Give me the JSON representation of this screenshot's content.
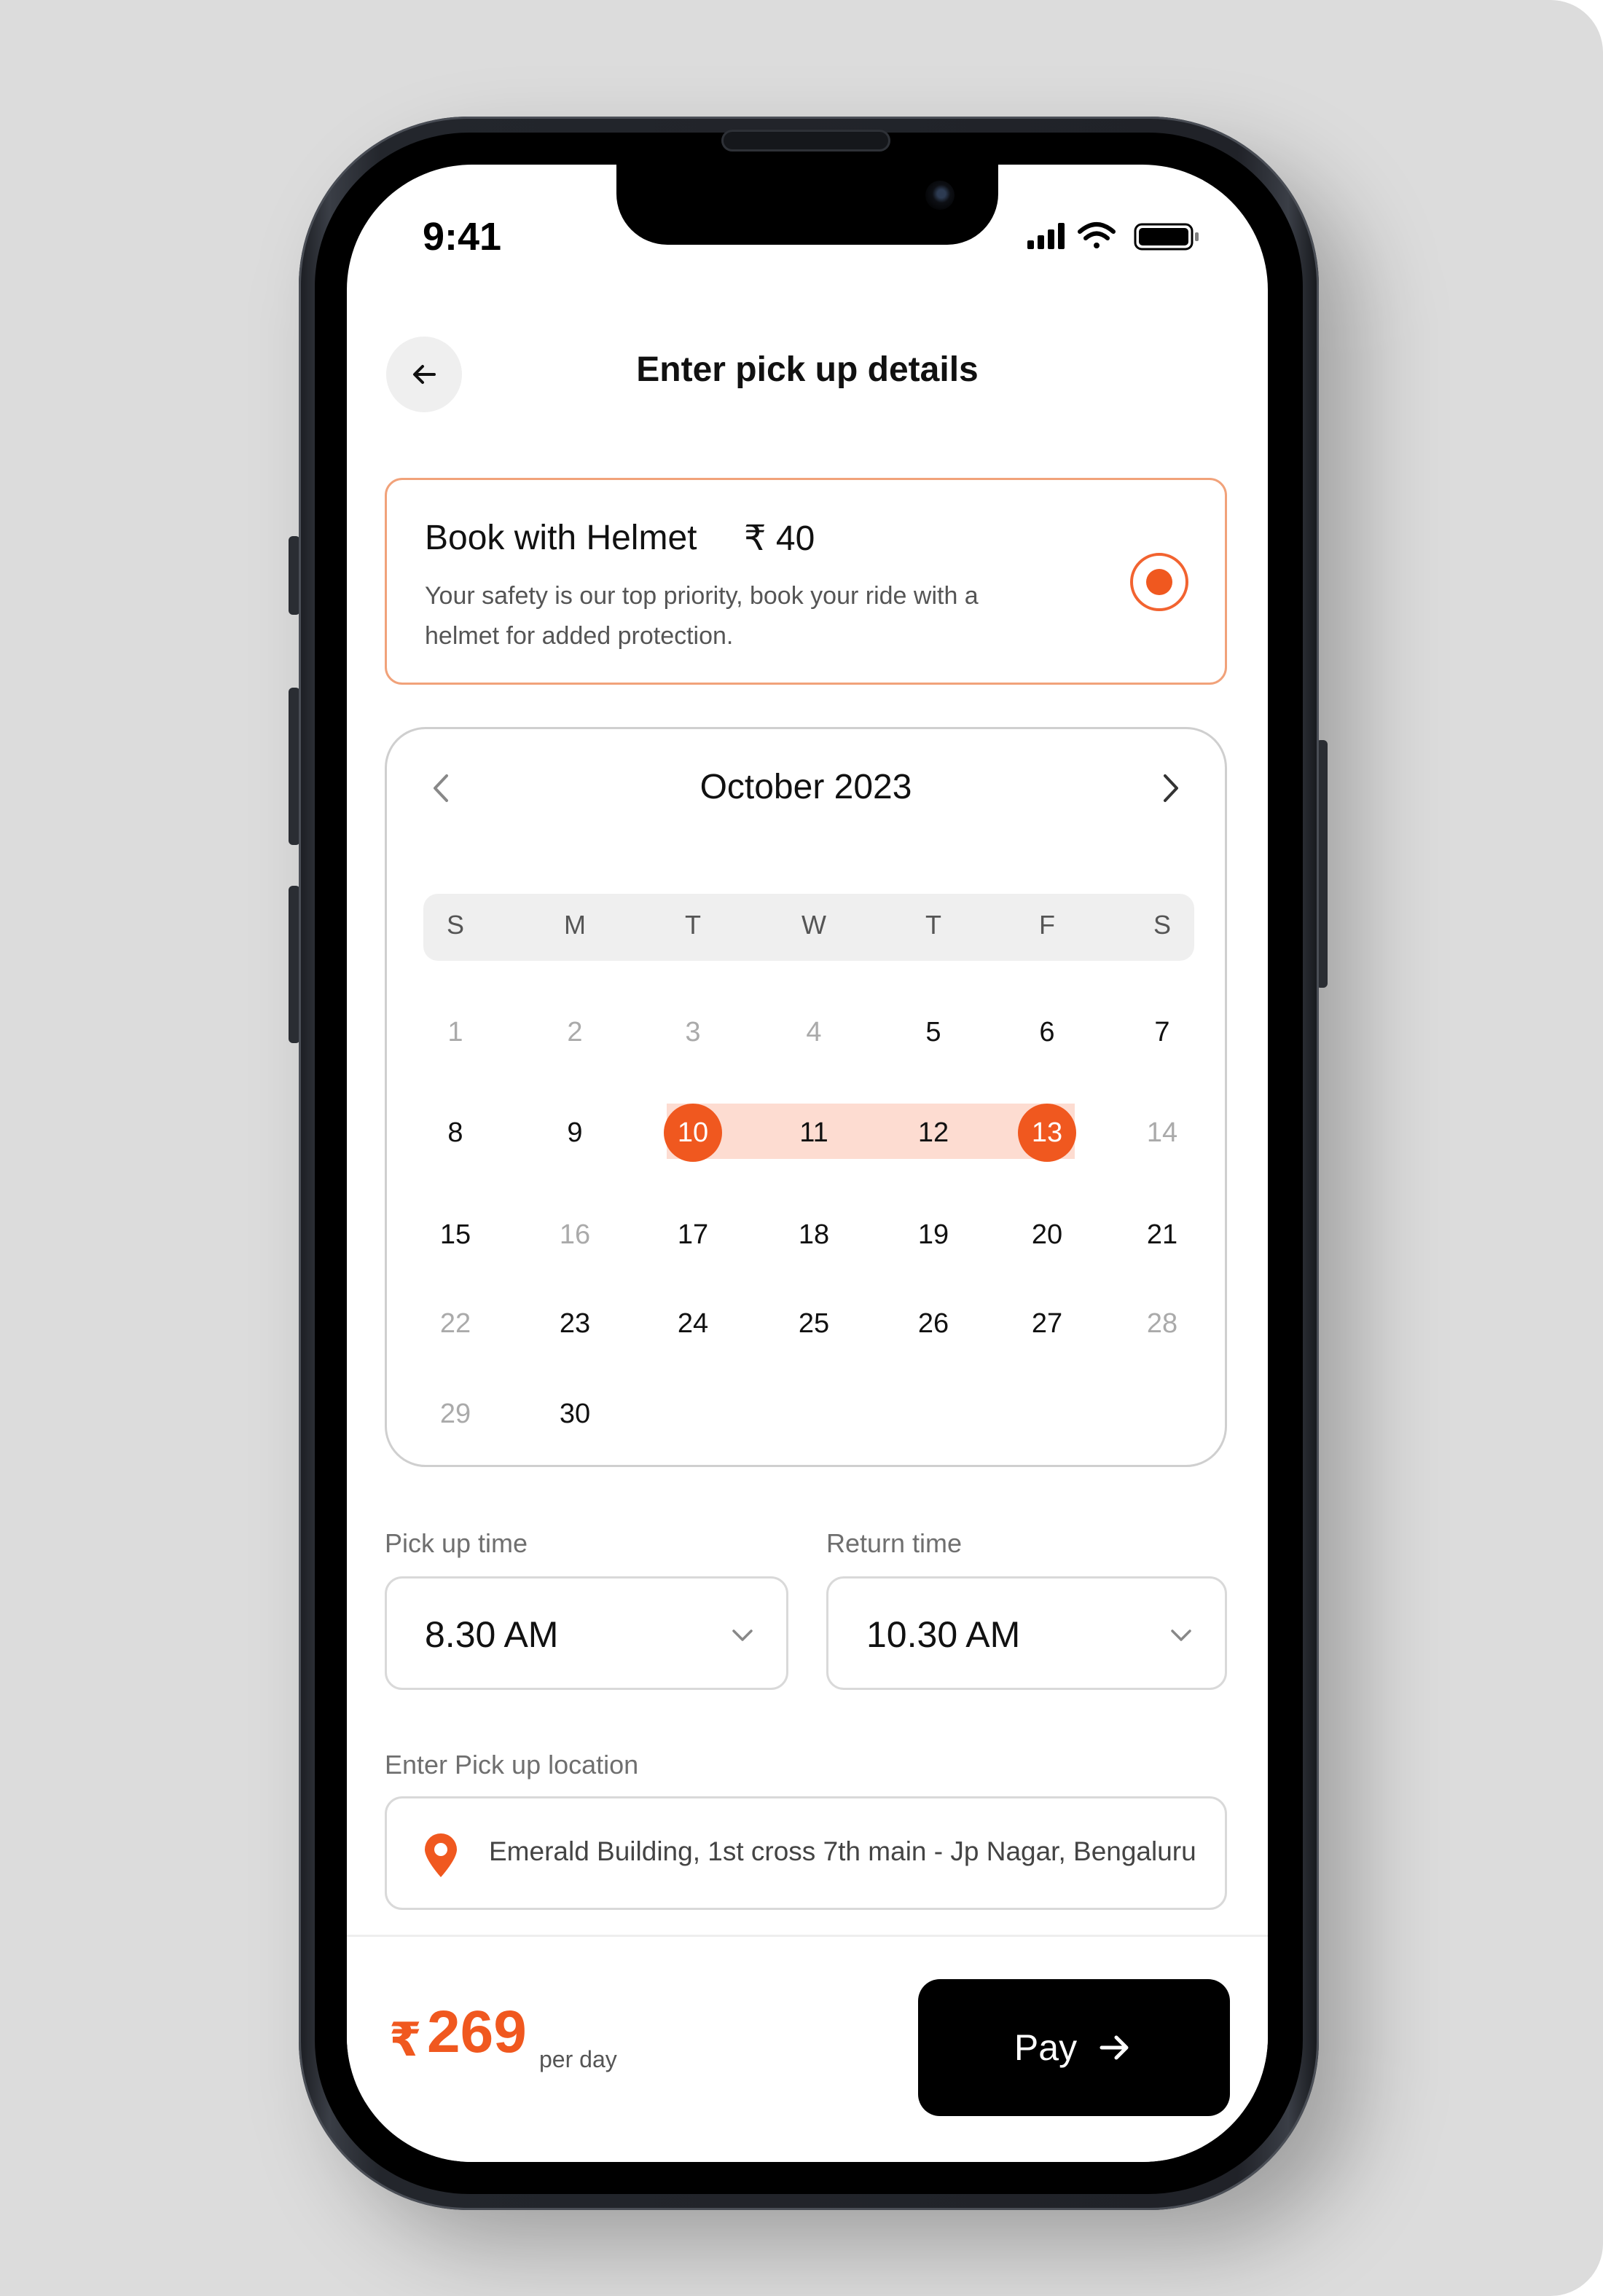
{
  "status_bar": {
    "time": "9:41"
  },
  "header": {
    "title": "Enter pick up details"
  },
  "helmet_option": {
    "title": "Book with Helmet",
    "price": "₹ 40",
    "description": "Your safety is our top priority, book your ride with a helmet for added protection.",
    "selected": true
  },
  "calendar": {
    "month_label": "October 2023",
    "weekdays": [
      "S",
      "M",
      "T",
      "W",
      "T",
      "F",
      "S"
    ],
    "weeks": [
      [
        {
          "d": "1",
          "s": "muted"
        },
        {
          "d": "2",
          "s": "muted"
        },
        {
          "d": "3",
          "s": "muted"
        },
        {
          "d": "4",
          "s": "muted"
        },
        {
          "d": "5",
          "s": ""
        },
        {
          "d": "6",
          "s": ""
        },
        {
          "d": "7",
          "s": ""
        }
      ],
      [
        {
          "d": "8",
          "s": ""
        },
        {
          "d": "9",
          "s": ""
        },
        {
          "d": "10",
          "s": "selected"
        },
        {
          "d": "11",
          "s": "range"
        },
        {
          "d": "12",
          "s": "range"
        },
        {
          "d": "13",
          "s": "selected"
        },
        {
          "d": "14",
          "s": "muted"
        }
      ],
      [
        {
          "d": "15",
          "s": ""
        },
        {
          "d": "16",
          "s": "muted"
        },
        {
          "d": "17",
          "s": ""
        },
        {
          "d": "18",
          "s": ""
        },
        {
          "d": "19",
          "s": ""
        },
        {
          "d": "20",
          "s": ""
        },
        {
          "d": "21",
          "s": ""
        }
      ],
      [
        {
          "d": "22",
          "s": "muted"
        },
        {
          "d": "23",
          "s": ""
        },
        {
          "d": "24",
          "s": ""
        },
        {
          "d": "25",
          "s": ""
        },
        {
          "d": "26",
          "s": ""
        },
        {
          "d": "27",
          "s": ""
        },
        {
          "d": "28",
          "s": "muted"
        }
      ],
      [
        {
          "d": "29",
          "s": "muted"
        },
        {
          "d": "30",
          "s": ""
        }
      ]
    ]
  },
  "pickup_time": {
    "label": "Pick up time",
    "value": "8.30 AM"
  },
  "return_time": {
    "label": "Return time",
    "value": "10.30 AM"
  },
  "location": {
    "label": "Enter Pick up location",
    "value": "Emerald Building, 1st cross 7th main - Jp Nagar, Bengaluru"
  },
  "footer": {
    "currency": "₹",
    "price": "269",
    "unit": "per day",
    "pay_label": "Pay"
  },
  "colors": {
    "accent": "#f0581f",
    "range": "#fddcd1",
    "border": "#d9d9d9",
    "muted_text": "#aaaaaa"
  }
}
